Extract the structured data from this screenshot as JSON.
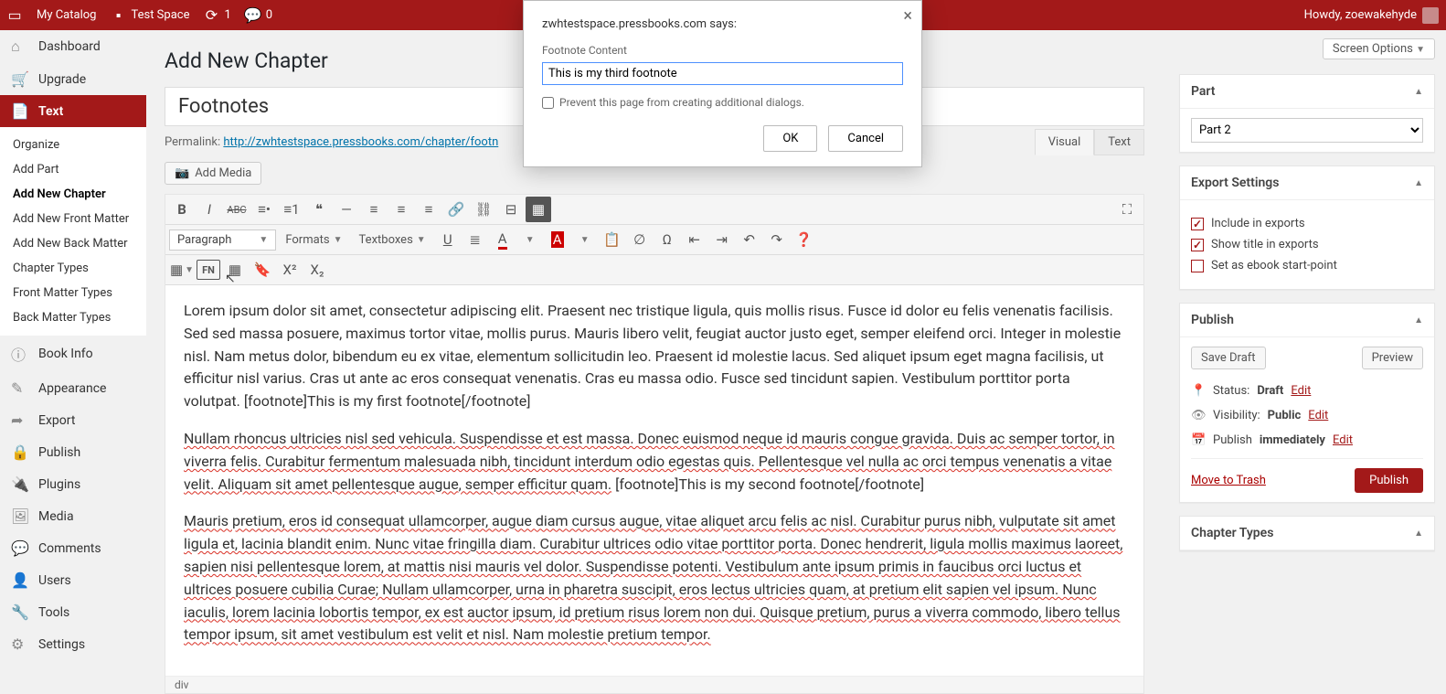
{
  "adminbar": {
    "catalog": "My Catalog",
    "space": "Test Space",
    "refresh_count": "1",
    "comment_count": "0",
    "howdy": "Howdy, zoewakehyde"
  },
  "sidebar": {
    "items": [
      {
        "icon": "⌂",
        "label": "Dashboard"
      },
      {
        "icon": "🛒",
        "label": "Upgrade"
      },
      {
        "icon": "📄",
        "label": "Text",
        "current": true
      },
      {
        "icon": "ⓘ",
        "label": "Book Info"
      },
      {
        "icon": "✎",
        "label": "Appearance"
      },
      {
        "icon": "➦",
        "label": "Export"
      },
      {
        "icon": "🔒",
        "label": "Publish"
      },
      {
        "icon": "🔌",
        "label": "Plugins"
      },
      {
        "icon": "🖼",
        "label": "Media"
      },
      {
        "icon": "💬",
        "label": "Comments"
      },
      {
        "icon": "👤",
        "label": "Users"
      },
      {
        "icon": "🔧",
        "label": "Tools"
      },
      {
        "icon": "⚙",
        "label": "Settings"
      }
    ],
    "submenu": [
      "Organize",
      "Add Part",
      "Add New Chapter",
      "Add New Front Matter",
      "Add New Back Matter",
      "Chapter Types",
      "Front Matter Types",
      "Back Matter Types"
    ],
    "submenu_active": "Add New Chapter"
  },
  "screen_options": "Screen Options",
  "page_title": "Add New Chapter",
  "chapter_title": "Footnotes",
  "permalink_label": "Permalink:",
  "permalink_url": "http://zwhtestspace.pressbooks.com/chapter/footn",
  "add_media": "Add Media",
  "editor_tabs": {
    "visual": "Visual",
    "text": "Text"
  },
  "toolbar": {
    "paragraph": "Paragraph",
    "formats": "Formats",
    "textboxes": "Textboxes",
    "fn": "FN"
  },
  "content": {
    "p1": "Lorem ipsum dolor sit amet, consectetur adipiscing elit. Praesent nec tristique ligula, quis mollis risus. Fusce id dolor eu felis venenatis facilisis. Sed sed massa posuere, maximus tortor vitae, mollis purus. Mauris libero velit, feugiat auctor justo eget, semper eleifend orci. Integer in molestie nisl. Nam metus dolor, bibendum eu ex vitae, elementum sollicitudin leo. Praesent id molestie lacus. Sed aliquet ipsum eget magna facilisis, ut efficitur nisl varius. Cras ut ante ac eros consequat venenatis. Cras eu massa odio. Fusce sed tincidunt sapien. Vestibulum porttitor porta volutpat. [footnote]This is my first footnote[/footnote]",
    "p2_a": "Nullam rhoncus ultricies nisl sed vehicula. Suspendisse",
    "p2_b": " et est massa. Donec euismod neque id mauris congue gravida. Duis ac semper tortor, in viverra felis. Curabitur fermentum malesuada nibh, tincidunt interdum odio egestas quis. Pellentesque vel nulla ac orci tempus venenatis a vitae velit. Aliquam sit amet pellentesque augue, semper efficitur quam.",
    "p2_c": " [footnote]This is my second footnote[/footnote]",
    "p3_a": "Mauris pretium, eros id consequat ullamcorper, augue diam cursus augue, vitae aliquet arcu felis ac nisl. Curabitur purus nibh, vulputate sit amet ligula et, lacinia blandit enim. Nunc vitae fringilla diam. Curabitur ultrices odio vitae porttitor porta. Donec hendrerit, ligula mollis maximus laoreet, sapien nisi pellentesque lorem, at mattis nisi mauris vel dolor. Suspendisse potenti.",
    "p3_b": " Vestibulum ante ipsum primis in faucibus orci luctus et ultrices posuere cubilia Curae; Nullam ullamcorper, urna in pharetra suscipit, eros lectus ultricies quam, at pretium elit sapien vel ipsum. Nunc iaculis, lorem lacinia lobortis tempor, ex est auctor ipsum, id pretium risus lorem non dui. Quisque pretium, purus a viverra commodo, libero tellus tempor ipsum, sit amet vestibulum est velit et nisl. Nam molestie pretium tempor."
  },
  "status_path": "div",
  "boxes": {
    "part": {
      "title": "Part",
      "value": "Part 2"
    },
    "export": {
      "title": "Export Settings",
      "include": "Include in exports",
      "show_title": "Show title in exports",
      "ebook": "Set as ebook start-point"
    },
    "publish": {
      "title": "Publish",
      "save_draft": "Save Draft",
      "preview": "Preview",
      "status_label": "Status:",
      "status_value": "Draft",
      "visibility_label": "Visibility:",
      "visibility_value": "Public",
      "publish_label": "Publish",
      "publish_value": "immediately",
      "edit": "Edit",
      "trash": "Move to Trash",
      "button": "Publish"
    },
    "chapter_types": {
      "title": "Chapter Types"
    }
  },
  "dialog": {
    "says": "zwhtestspace.pressbooks.com says:",
    "label": "Footnote Content",
    "value": "This is my third footnote",
    "prevent": "Prevent this page from creating additional dialogs.",
    "ok": "OK",
    "cancel": "Cancel"
  }
}
